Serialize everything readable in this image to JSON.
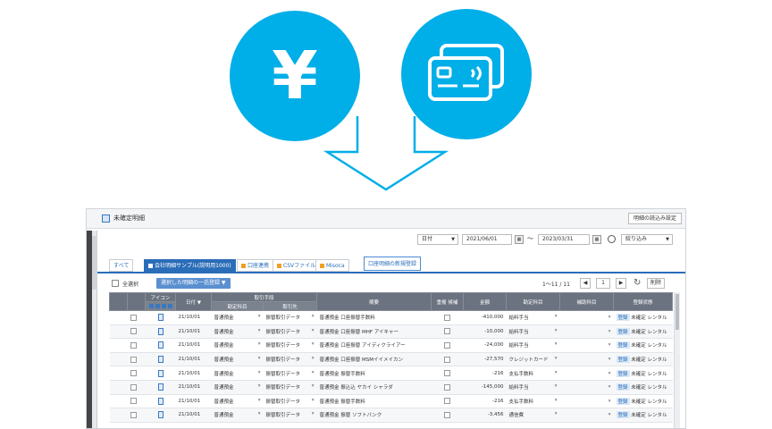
{
  "illustration": {
    "yen_symbol": "¥",
    "circle_color": "#00aee8",
    "icons": [
      "yen-icon",
      "credit-card-icon",
      "down-arrow-icon"
    ]
  },
  "window": {
    "title": "未確定明細",
    "top_right_button": "明細の読込み設定"
  },
  "filters": {
    "period_select": "日付",
    "date_from": "2021/06/01",
    "date_to": "2023/03/31",
    "narrow_select": "絞り込み"
  },
  "tabs": {
    "all": "すべて",
    "active": "会社明細サンプル(説明用1000)",
    "tab2": "口座連携",
    "tab3": "CSVファイル",
    "tab4": "Misoca",
    "extra_button": "口座明細の新規登録"
  },
  "toolbar": {
    "select_all": "全選択",
    "bulk_button": "選択した明細の一括登録",
    "pager_text": "1〜11 / 11",
    "page": "1",
    "delete_label": "削除"
  },
  "table": {
    "headers": {
      "icon": "アイコン",
      "date": "日付",
      "partner_group": "取引手段",
      "sub_account": "勘定科目",
      "sub_partner": "取引先",
      "summary": "摘要",
      "duplicate": "重複\n候補",
      "amount": "金額",
      "account": "勘定科目",
      "sub_item": "補助科目",
      "registration": "登録状態"
    },
    "rows": [
      {
        "date": "21/10/01",
        "a": "普通預金",
        "b": "振替取引データ",
        "summary": "普通預金 口座振替手数料",
        "amount": "-410,000",
        "account": "給料手当",
        "reg": "未確定"
      },
      {
        "date": "21/10/01",
        "a": "普通預金",
        "b": "振替取引データ",
        "summary": "普通預金 口座振替 MHF アイキャー",
        "amount": "-10,000",
        "account": "給料手当",
        "reg": "未確定"
      },
      {
        "date": "21/10/01",
        "a": "普通預金",
        "b": "振替取引データ",
        "summary": "普通預金 口座振替 アイディクライアー",
        "amount": "-24,000",
        "account": "給料手当",
        "reg": "未確定"
      },
      {
        "date": "21/10/01",
        "a": "普通預金",
        "b": "振替取引データ",
        "summary": "普通預金 口座振替 MSMイイメイカン",
        "amount": "-27,570",
        "account": "クレジットカード",
        "reg": "未確定"
      },
      {
        "date": "21/10/01",
        "a": "普通預金",
        "b": "振替取引データ",
        "summary": "普通預金 振替手数料",
        "amount": "-216",
        "account": "支払手数料",
        "reg": "未確定"
      },
      {
        "date": "21/10/01",
        "a": "普通預金",
        "b": "振替取引データ",
        "summary": "普通預金 振込込 ヤカイ シャラダ",
        "amount": "-145,000",
        "account": "給料手当",
        "reg": "未確定"
      },
      {
        "date": "21/10/01",
        "a": "普通預金",
        "b": "振替取引データ",
        "summary": "普通預金 振替手数料",
        "amount": "-216",
        "account": "支払手数料",
        "reg": "未確定"
      },
      {
        "date": "21/10/01",
        "a": "普通預金",
        "b": "振替取引データ",
        "summary": "普通預金 振替 ソフトバンク",
        "amount": "-3,456",
        "account": "通信費",
        "reg": "未確定"
      }
    ],
    "reg_tag": "登録",
    "reg_sub": "レンタル"
  }
}
